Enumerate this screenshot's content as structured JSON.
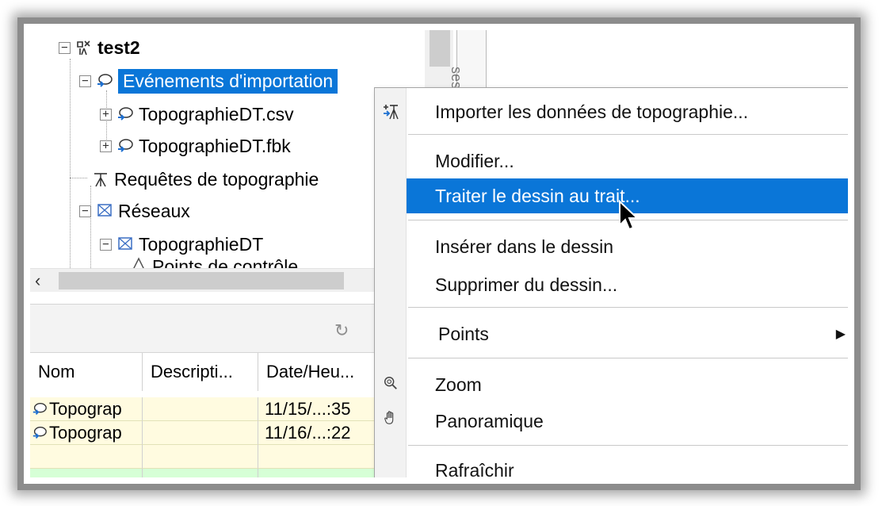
{
  "tree": {
    "root_label": "test2",
    "items": [
      {
        "label": "Evénements d'importation",
        "selected": true
      },
      {
        "label": "TopographieDT.csv"
      },
      {
        "label": "TopographieDT.fbk"
      },
      {
        "label": "Requêtes de topographie"
      },
      {
        "label": "Réseaux"
      },
      {
        "label": "TopographieDT"
      },
      {
        "label": "Points de contrôle"
      }
    ],
    "side_tab_label": "ses"
  },
  "grid": {
    "columns": [
      "Nom",
      "Descripti...",
      "Date/Heu..."
    ],
    "rows": [
      [
        "Topograp",
        "",
        "11/15/...:35"
      ],
      [
        "Topograp",
        "",
        "11/16/...:22"
      ]
    ]
  },
  "context_menu": {
    "items": [
      {
        "label": "Importer les données de topographie...",
        "icon": "import-survey-icon"
      },
      {
        "label": "Modifier..."
      },
      {
        "label": "Traiter le dessin au trait...",
        "highlighted": true
      },
      {
        "label": "Insérer dans le dessin"
      },
      {
        "label": "Supprimer du dessin..."
      },
      {
        "label": "Points",
        "has_submenu": true
      },
      {
        "label": "Zoom",
        "icon": "zoom-icon"
      },
      {
        "label": "Panoramique",
        "icon": "pan-hand-icon"
      },
      {
        "label": "Rafraîchir"
      }
    ]
  },
  "colors": {
    "selection": "#0a76d8",
    "grid_row_yellow": "#fffbe0",
    "grid_row_green": "#d6ffd6"
  }
}
